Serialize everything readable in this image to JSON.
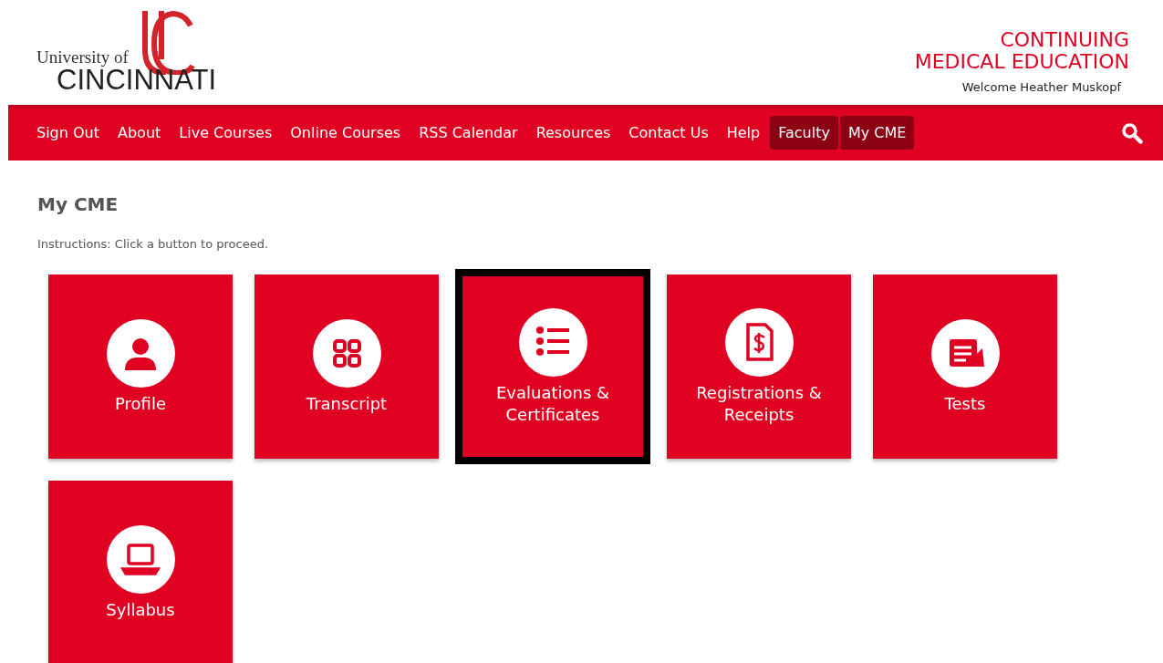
{
  "header": {
    "logo_line_1": "University of",
    "logo_line_2": "CINCINNATI",
    "site_title_1": "CONTINUING",
    "site_title_2": "MEDICAL EDUCATION",
    "welcome": "Welcome Heather Muskopf"
  },
  "nav": [
    {
      "label": "Sign Out",
      "highlighted": false
    },
    {
      "label": "About",
      "highlighted": false
    },
    {
      "label": "Live Courses",
      "highlighted": false
    },
    {
      "label": "Online Courses",
      "highlighted": false
    },
    {
      "label": "RSS Calendar",
      "highlighted": false
    },
    {
      "label": "Resources",
      "highlighted": false
    },
    {
      "label": "Contact Us",
      "highlighted": false
    },
    {
      "label": "Help",
      "highlighted": false
    },
    {
      "label": "Faculty",
      "highlighted": true
    },
    {
      "label": "My CME",
      "highlighted": true
    }
  ],
  "page": {
    "title": "My CME",
    "instructions": "Instructions: Click a button to proceed."
  },
  "tiles": [
    {
      "label": "Profile",
      "kind": "person",
      "selected": false
    },
    {
      "label": "Transcript",
      "kind": "grid",
      "selected": false
    },
    {
      "label": "Evaluations & Certificates",
      "kind": "list",
      "selected": true
    },
    {
      "label": "Registrations & Receipts",
      "kind": "receipt",
      "selected": false
    },
    {
      "label": "Tests",
      "kind": "document",
      "selected": false
    },
    {
      "label": "Syllabus",
      "kind": "laptop",
      "selected": false
    }
  ]
}
